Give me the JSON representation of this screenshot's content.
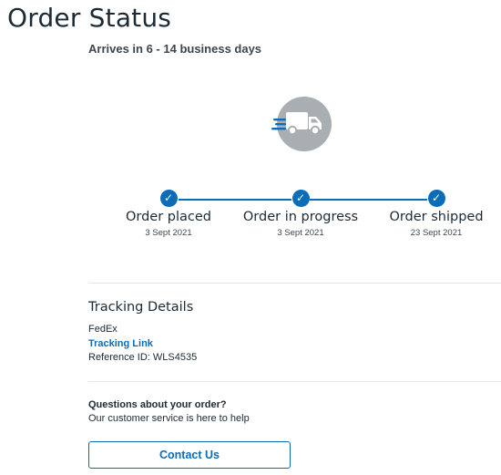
{
  "page": {
    "title": "Order Status",
    "arrival_text": "Arrives in 6 - 14 business days"
  },
  "status_icon": "delivery-truck-icon",
  "tracker": {
    "steps": [
      {
        "label": "Order placed",
        "date": "3 Sept 2021",
        "completed": true
      },
      {
        "label": "Order in progress",
        "date": "3 Sept 2021",
        "completed": true
      },
      {
        "label": "Order shipped",
        "date": "23 Sept 2021",
        "completed": true
      }
    ],
    "check_glyph": "✓"
  },
  "tracking": {
    "heading": "Tracking Details",
    "carrier": "FedEx",
    "link_label": "Tracking Link",
    "reference": "Reference ID: WLS4535"
  },
  "support": {
    "heading": "Questions about your order?",
    "subtext": "Our customer service is here to help",
    "button_label": "Contact Us"
  },
  "colors": {
    "accent": "#0b6cb8",
    "text": "#1c2a35",
    "icon_badge": "#a9aeb3"
  }
}
